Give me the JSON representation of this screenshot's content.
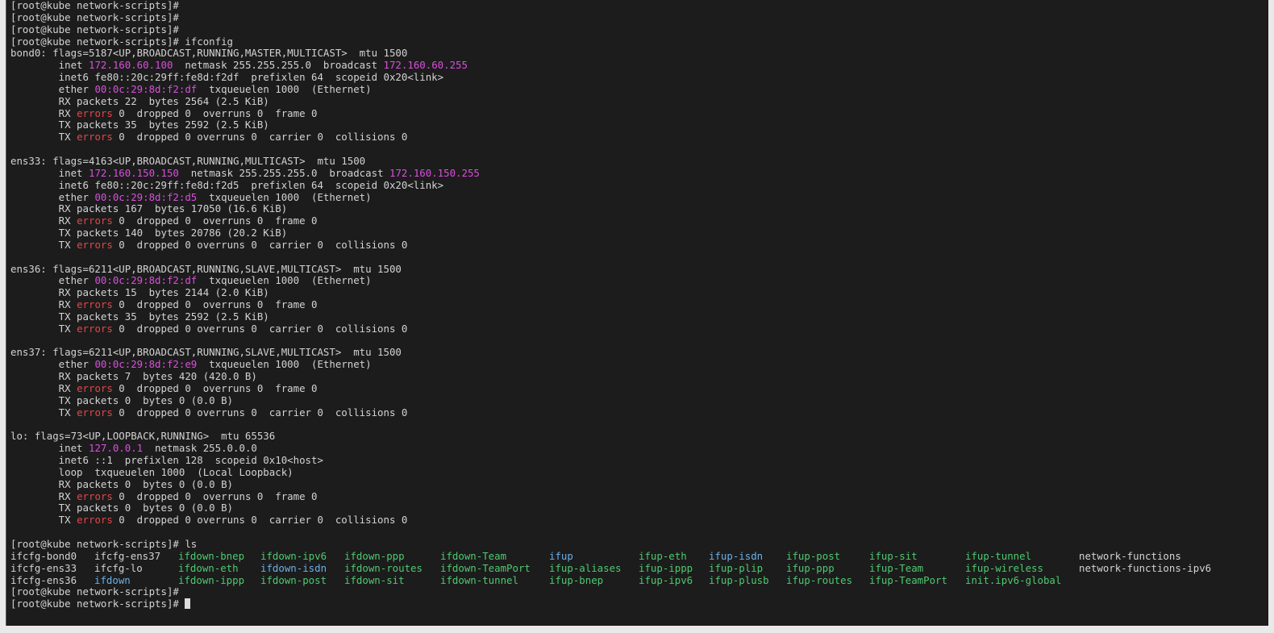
{
  "colors": {
    "default": "#d3d3d3",
    "magenta": "#d94fdc",
    "red": "#e0484b",
    "green": "#4ec970",
    "cyan": "#6ab0e8",
    "background": "#1c1c1c",
    "chrome": "#e9e9e9"
  },
  "terminal": {
    "lines": [
      [
        {
          "t": "[root@kube network-scripts]#"
        }
      ],
      [
        {
          "t": "[root@kube network-scripts]#"
        }
      ],
      [
        {
          "t": "[root@kube network-scripts]#"
        }
      ],
      [
        {
          "t": "[root@kube network-scripts]# ifconfig"
        }
      ],
      [
        {
          "t": "bond0: flags=5187<UP,BROADCAST,RUNNING,MASTER,MULTICAST>  mtu 1500"
        }
      ],
      [
        {
          "t": "        inet "
        },
        {
          "t": "172.160.60.100",
          "c": "magenta"
        },
        {
          "t": "  netmask 255.255.255.0  broadcast "
        },
        {
          "t": "172.160.60.255",
          "c": "magenta"
        }
      ],
      [
        {
          "t": "        inet6 fe80::20c:29ff:fe8d:f2df  prefixlen 64  scopeid 0x20<link>"
        }
      ],
      [
        {
          "t": "        ether "
        },
        {
          "t": "00:0c:29:8d:f2:df",
          "c": "magenta"
        },
        {
          "t": "  txqueuelen 1000  (Ethernet)"
        }
      ],
      [
        {
          "t": "        RX packets 22  bytes 2564 (2.5 KiB)"
        }
      ],
      [
        {
          "t": "        RX "
        },
        {
          "t": "errors",
          "c": "red"
        },
        {
          "t": " 0  dropped 0  overruns 0  frame 0"
        }
      ],
      [
        {
          "t": "        TX packets 35  bytes 2592 (2.5 KiB)"
        }
      ],
      [
        {
          "t": "        TX "
        },
        {
          "t": "errors",
          "c": "red"
        },
        {
          "t": " 0  dropped 0 overruns 0  carrier 0  collisions 0"
        }
      ],
      [
        {
          "t": ""
        }
      ],
      [
        {
          "t": "ens33: flags=4163<UP,BROADCAST,RUNNING,MULTICAST>  mtu 1500"
        }
      ],
      [
        {
          "t": "        inet "
        },
        {
          "t": "172.160.150.150",
          "c": "magenta"
        },
        {
          "t": "  netmask 255.255.255.0  broadcast "
        },
        {
          "t": "172.160.150.255",
          "c": "magenta"
        }
      ],
      [
        {
          "t": "        inet6 fe80::20c:29ff:fe8d:f2d5  prefixlen 64  scopeid 0x20<link>"
        }
      ],
      [
        {
          "t": "        ether "
        },
        {
          "t": "00:0c:29:8d:f2:d5",
          "c": "magenta"
        },
        {
          "t": "  txqueuelen 1000  (Ethernet)"
        }
      ],
      [
        {
          "t": "        RX packets 167  bytes 17050 (16.6 KiB)"
        }
      ],
      [
        {
          "t": "        RX "
        },
        {
          "t": "errors",
          "c": "red"
        },
        {
          "t": " 0  dropped 0  overruns 0  frame 0"
        }
      ],
      [
        {
          "t": "        TX packets 140  bytes 20786 (20.2 KiB)"
        }
      ],
      [
        {
          "t": "        TX "
        },
        {
          "t": "errors",
          "c": "red"
        },
        {
          "t": " 0  dropped 0 overruns 0  carrier 0  collisions 0"
        }
      ],
      [
        {
          "t": ""
        }
      ],
      [
        {
          "t": "ens36: flags=6211<UP,BROADCAST,RUNNING,SLAVE,MULTICAST>  mtu 1500"
        }
      ],
      [
        {
          "t": "        ether "
        },
        {
          "t": "00:0c:29:8d:f2:df",
          "c": "magenta"
        },
        {
          "t": "  txqueuelen 1000  (Ethernet)"
        }
      ],
      [
        {
          "t": "        RX packets 15  bytes 2144 (2.0 KiB)"
        }
      ],
      [
        {
          "t": "        RX "
        },
        {
          "t": "errors",
          "c": "red"
        },
        {
          "t": " 0  dropped 0  overruns 0  frame 0"
        }
      ],
      [
        {
          "t": "        TX packets 35  bytes 2592 (2.5 KiB)"
        }
      ],
      [
        {
          "t": "        TX "
        },
        {
          "t": "errors",
          "c": "red"
        },
        {
          "t": " 0  dropped 0 overruns 0  carrier 0  collisions 0"
        }
      ],
      [
        {
          "t": ""
        }
      ],
      [
        {
          "t": "ens37: flags=6211<UP,BROADCAST,RUNNING,SLAVE,MULTICAST>  mtu 1500"
        }
      ],
      [
        {
          "t": "        ether "
        },
        {
          "t": "00:0c:29:8d:f2:e9",
          "c": "magenta"
        },
        {
          "t": "  txqueuelen 1000  (Ethernet)"
        }
      ],
      [
        {
          "t": "        RX packets 7  bytes 420 (420.0 B)"
        }
      ],
      [
        {
          "t": "        RX "
        },
        {
          "t": "errors",
          "c": "red"
        },
        {
          "t": " 0  dropped 0  overruns 0  frame 0"
        }
      ],
      [
        {
          "t": "        TX packets 0  bytes 0 (0.0 B)"
        }
      ],
      [
        {
          "t": "        TX "
        },
        {
          "t": "errors",
          "c": "red"
        },
        {
          "t": " 0  dropped 0 overruns 0  carrier 0  collisions 0"
        }
      ],
      [
        {
          "t": ""
        }
      ],
      [
        {
          "t": "lo: flags=73<UP,LOOPBACK,RUNNING>  mtu 65536"
        }
      ],
      [
        {
          "t": "        inet "
        },
        {
          "t": "127.0.0.1",
          "c": "magenta"
        },
        {
          "t": "  netmask 255.0.0.0"
        }
      ],
      [
        {
          "t": "        inet6 ::1  prefixlen 128  scopeid 0x10<host>"
        }
      ],
      [
        {
          "t": "        loop  txqueuelen 1000  (Local Loopback)"
        }
      ],
      [
        {
          "t": "        RX packets 0  bytes 0 (0.0 B)"
        }
      ],
      [
        {
          "t": "        RX "
        },
        {
          "t": "errors",
          "c": "red"
        },
        {
          "t": " 0  dropped 0  overruns 0  frame 0"
        }
      ],
      [
        {
          "t": "        TX packets 0  bytes 0 (0.0 B)"
        }
      ],
      [
        {
          "t": "        TX "
        },
        {
          "t": "errors",
          "c": "red"
        },
        {
          "t": " 0  dropped 0 overruns 0  carrier 0  collisions 0"
        }
      ],
      [
        {
          "t": ""
        }
      ],
      [
        {
          "t": "[root@kube network-scripts]# ls"
        }
      ]
    ],
    "ls_rows": [
      [
        {
          "t": "ifcfg-bond0"
        },
        {
          "t": "ifcfg-ens37"
        },
        {
          "t": "ifdown-bnep",
          "c": "green"
        },
        {
          "t": "ifdown-ipv6",
          "c": "green"
        },
        {
          "t": "ifdown-ppp",
          "c": "green"
        },
        {
          "t": "ifdown-Team",
          "c": "green"
        },
        {
          "t": "ifup",
          "c": "cyan"
        },
        {
          "t": "ifup-eth",
          "c": "green"
        },
        {
          "t": "ifup-isdn",
          "c": "cyan"
        },
        {
          "t": "ifup-post",
          "c": "green"
        },
        {
          "t": "ifup-sit",
          "c": "green"
        },
        {
          "t": "ifup-tunnel",
          "c": "green"
        },
        {
          "t": "network-functions"
        }
      ],
      [
        {
          "t": "ifcfg-ens33"
        },
        {
          "t": "ifcfg-lo"
        },
        {
          "t": "ifdown-eth",
          "c": "green"
        },
        {
          "t": "ifdown-isdn",
          "c": "cyan"
        },
        {
          "t": "ifdown-routes",
          "c": "green"
        },
        {
          "t": "ifdown-TeamPort",
          "c": "green"
        },
        {
          "t": "ifup-aliases",
          "c": "green"
        },
        {
          "t": "ifup-ippp",
          "c": "green"
        },
        {
          "t": "ifup-plip",
          "c": "green"
        },
        {
          "t": "ifup-ppp",
          "c": "green"
        },
        {
          "t": "ifup-Team",
          "c": "green"
        },
        {
          "t": "ifup-wireless",
          "c": "green"
        },
        {
          "t": "network-functions-ipv6"
        }
      ],
      [
        {
          "t": "ifcfg-ens36"
        },
        {
          "t": "ifdown",
          "c": "cyan"
        },
        {
          "t": "ifdown-ippp",
          "c": "green"
        },
        {
          "t": "ifdown-post",
          "c": "green"
        },
        {
          "t": "ifdown-sit",
          "c": "green"
        },
        {
          "t": "ifdown-tunnel",
          "c": "green"
        },
        {
          "t": "ifup-bnep",
          "c": "green"
        },
        {
          "t": "ifup-ipv6",
          "c": "green"
        },
        {
          "t": "ifup-plusb",
          "c": "green"
        },
        {
          "t": "ifup-routes",
          "c": "green"
        },
        {
          "t": "ifup-TeamPort",
          "c": "green"
        },
        {
          "t": "init.ipv6-global",
          "c": "green"
        }
      ]
    ],
    "tail_lines": [
      [
        {
          "t": "[root@kube network-scripts]#"
        }
      ],
      [
        {
          "t": "[root@kube network-scripts]# "
        }
      ]
    ]
  }
}
